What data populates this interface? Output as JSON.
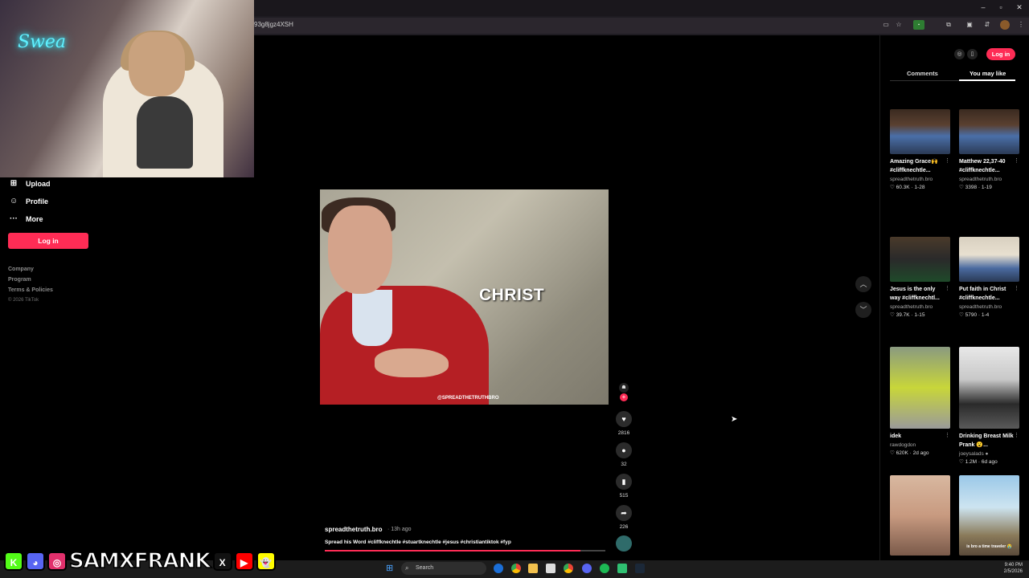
{
  "browser": {
    "url_fragment": "93g8jgz4XSH",
    "window_controls": [
      "–",
      "▫",
      "✕"
    ]
  },
  "webcam": {
    "neon_sign": "Swea"
  },
  "sidebar": {
    "items": [
      {
        "icon": "plus-square-icon",
        "label": "Upload"
      },
      {
        "icon": "person-icon",
        "label": "Profile"
      },
      {
        "icon": "ellipsis-icon",
        "label": "More"
      }
    ],
    "login_label": "Log in",
    "footer_links": [
      "Company",
      "Program",
      "Terms & Policies"
    ],
    "copyright": "© 2026 TikTok"
  },
  "video": {
    "caption_overlay": "CHRIST",
    "watermark": "@SPREADTHETRUTHBRO",
    "author": "spreadthetruth.bro",
    "posted": "· 13h ago",
    "description": "Spread his Word #cliffknechtle #stuartknechtle #jesus #christiantiktok #fyp",
    "progress": 0.91,
    "actions": {
      "likes": "2816",
      "comments": "32",
      "saves": "515",
      "shares": "226"
    }
  },
  "right_panel": {
    "login_label": "Log in",
    "tabs": [
      {
        "label": "Comments",
        "active": false
      },
      {
        "label": "You may like",
        "active": true
      }
    ],
    "cards": [
      {
        "title": "Amazing Grace🙌 #cliffknechtle...",
        "author": "spreadthetruth.bro",
        "likes": "60.3K",
        "meta": "1-28",
        "thumb": "library"
      },
      {
        "title": "Matthew 22,37-40 #cliffknechtle...",
        "author": "spreadthetruth.bro",
        "likes": "3398",
        "meta": "1-19",
        "thumb": "library"
      },
      {
        "title": "Jesus is the only way #cliffknechtl...",
        "author": "spreadthetruth.bro",
        "likes": "39.7K",
        "meta": "1-15",
        "thumb": "study"
      },
      {
        "title": "Put faith in Christ #cliffknechtle...",
        "author": "spreadthetruth.bro",
        "likes": "5790",
        "meta": "1-4",
        "thumb": "office"
      },
      {
        "title": "idek",
        "author": "rawdogdon",
        "likes": "620K",
        "meta": "2d ago",
        "thumb": "textvid"
      },
      {
        "title": "Drinking Breast Milk Prank 😮...",
        "author": "joeysalads ●",
        "likes": "1.2M",
        "meta": "6d ago",
        "thumb": "kitchen"
      },
      {
        "title": "",
        "author": "",
        "likes": "",
        "meta": "",
        "thumb": "selfie"
      },
      {
        "title": "",
        "author": "",
        "likes": "",
        "meta": "",
        "thumb": "outdoor"
      }
    ],
    "card7_overlay": "is bro a time traveler 😭"
  },
  "taskbar": {
    "search_label": "Search",
    "time": "9:40 PM",
    "date": "2/5/2026"
  },
  "stream_overlay": {
    "handle": "SAMXFRANK",
    "icons": [
      {
        "name": "kick-icon",
        "glyph": "K",
        "color": "#53fc18"
      },
      {
        "name": "discord-icon",
        "glyph": "◕",
        "color": "#5865f2"
      },
      {
        "name": "instagram-icon",
        "glyph": "◎",
        "color": "#e1306c"
      },
      {
        "name": "x-icon",
        "glyph": "X",
        "color": "#111111"
      },
      {
        "name": "youtube-icon",
        "glyph": "▶",
        "color": "#ff0000"
      },
      {
        "name": "snapchat-icon",
        "glyph": "👻",
        "color": "#fffc00"
      }
    ]
  },
  "colors": {
    "accent": "#fe2c55",
    "background": "#000000",
    "panel": "#1f1c22"
  }
}
